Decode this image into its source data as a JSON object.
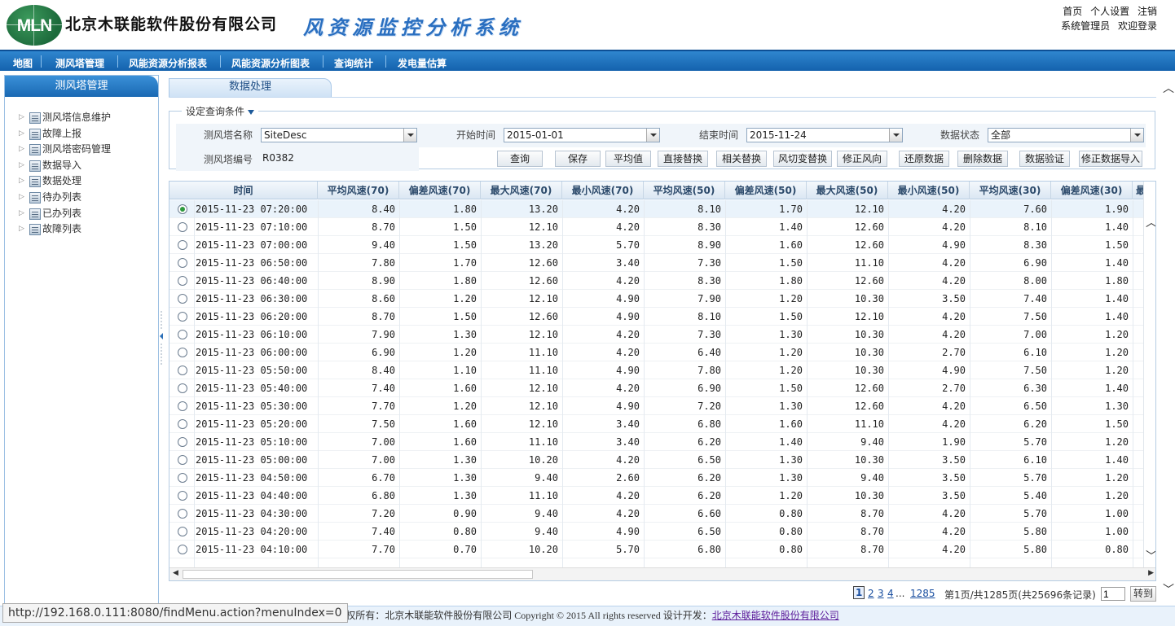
{
  "header": {
    "logo_text": "MLN",
    "company": "北京木联能软件股份有限公司",
    "system_title": "风资源监控分析系统",
    "links": [
      "首页",
      "个人设置",
      "注销"
    ],
    "user": "系统管理员",
    "welcome": "欢迎登录"
  },
  "nav": {
    "items": [
      "地图",
      "测风塔管理",
      "风能资源分析报表",
      "风能资源分析图表",
      "查询统计",
      "发电量估算"
    ]
  },
  "sidebar": {
    "title": "测风塔管理",
    "items": [
      "测风塔信息维护",
      "故障上报",
      "测风塔密码管理",
      "数据导入",
      "数据处理",
      "待办列表",
      "已办列表",
      "故障列表"
    ]
  },
  "main": {
    "tab": "数据处理",
    "conditions": {
      "legend": "设定查询条件",
      "tower_name_label": "测风塔名称",
      "tower_name_value": "SiteDesc",
      "start_label": "开始时间",
      "start_value": "2015-01-01",
      "end_label": "结束时间",
      "end_value": "2015-11-24",
      "status_label": "数据状态",
      "status_value": "全部",
      "tower_no_label": "测风塔编号",
      "tower_no_value": "R0382"
    },
    "actions": [
      "查询",
      "保存",
      "平均值",
      "直接替换",
      "相关替换",
      "风切变替换",
      "修正风向",
      "还原数据",
      "删除数据",
      "数据验证",
      "修正数据导入"
    ]
  },
  "table": {
    "columns": [
      "时间",
      "平均风速(70)",
      "偏差风速(70)",
      "最大风速(70)",
      "最小风速(70)",
      "平均风速(50)",
      "偏差风速(50)",
      "最大风速(50)",
      "最小风速(50)",
      "平均风速(30)",
      "偏差风速(30)",
      "最"
    ],
    "rows": [
      [
        "2015-11-23 07:20:00",
        "8.40",
        "1.80",
        "13.20",
        "4.20",
        "8.10",
        "1.70",
        "12.10",
        "4.20",
        "7.60",
        "1.90"
      ],
      [
        "2015-11-23 07:10:00",
        "8.70",
        "1.50",
        "12.10",
        "4.20",
        "8.30",
        "1.40",
        "12.60",
        "4.20",
        "8.10",
        "1.40"
      ],
      [
        "2015-11-23 07:00:00",
        "9.40",
        "1.50",
        "13.20",
        "5.70",
        "8.90",
        "1.60",
        "12.60",
        "4.90",
        "8.30",
        "1.50"
      ],
      [
        "2015-11-23 06:50:00",
        "7.80",
        "1.70",
        "12.60",
        "3.40",
        "7.30",
        "1.50",
        "11.10",
        "4.20",
        "6.90",
        "1.40"
      ],
      [
        "2015-11-23 06:40:00",
        "8.90",
        "1.80",
        "12.60",
        "4.20",
        "8.30",
        "1.80",
        "12.60",
        "4.20",
        "8.00",
        "1.80"
      ],
      [
        "2015-11-23 06:30:00",
        "8.60",
        "1.20",
        "12.10",
        "4.90",
        "7.90",
        "1.20",
        "10.30",
        "3.50",
        "7.40",
        "1.40"
      ],
      [
        "2015-11-23 06:20:00",
        "8.70",
        "1.50",
        "12.60",
        "4.90",
        "8.10",
        "1.50",
        "12.10",
        "4.20",
        "7.50",
        "1.40"
      ],
      [
        "2015-11-23 06:10:00",
        "7.90",
        "1.30",
        "12.10",
        "4.20",
        "7.30",
        "1.30",
        "10.30",
        "4.20",
        "7.00",
        "1.20"
      ],
      [
        "2015-11-23 06:00:00",
        "6.90",
        "1.20",
        "11.10",
        "4.20",
        "6.40",
        "1.20",
        "10.30",
        "2.70",
        "6.10",
        "1.20"
      ],
      [
        "2015-11-23 05:50:00",
        "8.40",
        "1.10",
        "11.10",
        "4.90",
        "7.80",
        "1.20",
        "10.30",
        "4.90",
        "7.50",
        "1.20"
      ],
      [
        "2015-11-23 05:40:00",
        "7.40",
        "1.60",
        "12.10",
        "4.20",
        "6.90",
        "1.50",
        "12.60",
        "2.70",
        "6.30",
        "1.40"
      ],
      [
        "2015-11-23 05:30:00",
        "7.70",
        "1.20",
        "12.10",
        "4.90",
        "7.20",
        "1.30",
        "12.60",
        "4.20",
        "6.50",
        "1.30"
      ],
      [
        "2015-11-23 05:20:00",
        "7.50",
        "1.60",
        "12.10",
        "3.40",
        "6.80",
        "1.60",
        "11.10",
        "4.20",
        "6.20",
        "1.50"
      ],
      [
        "2015-11-23 05:10:00",
        "7.00",
        "1.60",
        "11.10",
        "3.40",
        "6.20",
        "1.40",
        "9.40",
        "1.90",
        "5.70",
        "1.20"
      ],
      [
        "2015-11-23 05:00:00",
        "7.00",
        "1.30",
        "10.20",
        "4.20",
        "6.50",
        "1.30",
        "10.30",
        "3.50",
        "6.10",
        "1.40"
      ],
      [
        "2015-11-23 04:50:00",
        "6.70",
        "1.30",
        "9.40",
        "2.60",
        "6.20",
        "1.30",
        "9.40",
        "3.50",
        "5.70",
        "1.20"
      ],
      [
        "2015-11-23 04:40:00",
        "6.80",
        "1.30",
        "11.10",
        "4.20",
        "6.20",
        "1.20",
        "10.30",
        "3.50",
        "5.40",
        "1.20"
      ],
      [
        "2015-11-23 04:30:00",
        "7.20",
        "0.90",
        "9.40",
        "4.20",
        "6.60",
        "0.80",
        "8.70",
        "4.20",
        "5.70",
        "1.00"
      ],
      [
        "2015-11-23 04:20:00",
        "7.40",
        "0.80",
        "9.40",
        "4.90",
        "6.50",
        "0.80",
        "8.70",
        "4.20",
        "5.80",
        "1.00"
      ],
      [
        "2015-11-23 04:10:00",
        "7.70",
        "0.70",
        "10.20",
        "5.70",
        "6.80",
        "0.80",
        "8.70",
        "4.20",
        "5.80",
        "0.80"
      ]
    ],
    "selected_row": 0
  },
  "pager": {
    "current": "1",
    "pages": [
      "2",
      "3",
      "4"
    ],
    "ellipsis": "...",
    "last": "1285",
    "summary": "第1页/共1285页(共25696条记录)",
    "input_value": "1",
    "goto": "转到"
  },
  "footer": {
    "text": "版权所有：北京木联能软件股份有限公司  Copyright © 2015 All rights reserved 设计开发：",
    "link": "北京木联能软件股份有限公司"
  },
  "statusbar": {
    "url": "http://192.168.0.111:8080/findMenu.action?menuIndex=0"
  }
}
